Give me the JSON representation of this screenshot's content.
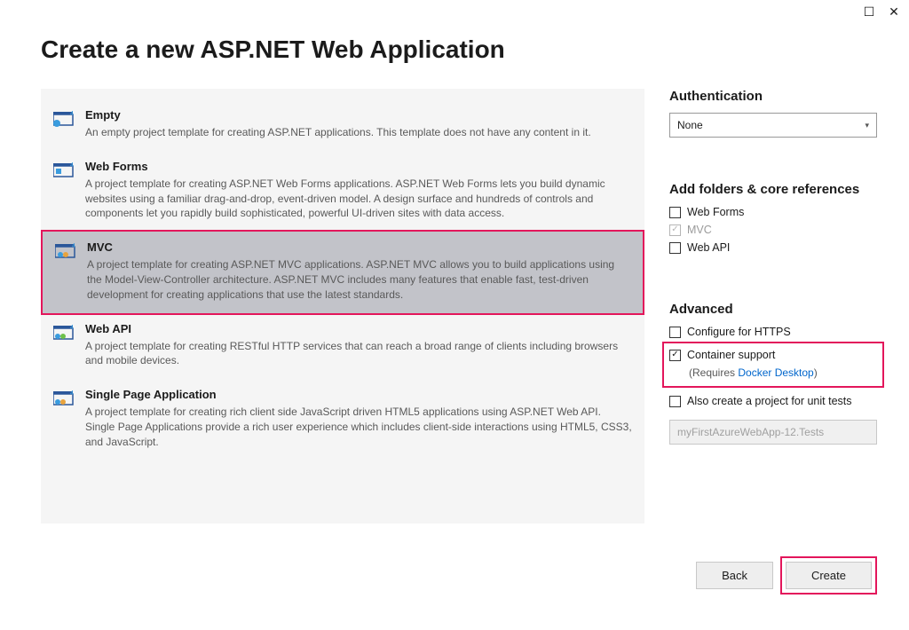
{
  "window": {
    "maximize": "☐",
    "close": "✕"
  },
  "title": "Create a new ASP.NET Web Application",
  "templates": [
    {
      "name": "Empty",
      "desc": "An empty project template for creating ASP.NET applications. This template does not have any content in it."
    },
    {
      "name": "Web Forms",
      "desc": "A project template for creating ASP.NET Web Forms applications. ASP.NET Web Forms lets you build dynamic websites using a familiar drag-and-drop, event-driven model. A design surface and hundreds of controls and components let you rapidly build sophisticated, powerful UI-driven sites with data access."
    },
    {
      "name": "MVC",
      "desc": "A project template for creating ASP.NET MVC applications. ASP.NET MVC allows you to build applications using the Model-View-Controller architecture. ASP.NET MVC includes many features that enable fast, test-driven development for creating applications that use the latest standards."
    },
    {
      "name": "Web API",
      "desc": "A project template for creating RESTful HTTP services that can reach a broad range of clients including browsers and mobile devices."
    },
    {
      "name": "Single Page Application",
      "desc": "A project template for creating rich client side JavaScript driven HTML5 applications using ASP.NET Web API. Single Page Applications provide a rich user experience which includes client-side interactions using HTML5, CSS3, and JavaScript."
    }
  ],
  "auth": {
    "heading": "Authentication",
    "value": "None"
  },
  "coreRefs": {
    "heading": "Add folders & core references",
    "webForms": "Web Forms",
    "mvc": "MVC",
    "webApi": "Web API"
  },
  "advanced": {
    "heading": "Advanced",
    "https": "Configure for HTTPS",
    "container": "Container support",
    "requiresPrefix": "(Requires ",
    "dockerLink": "Docker Desktop",
    "requiresSuffix": ")",
    "unitTests": "Also create a project for unit tests",
    "testProjectName": "myFirstAzureWebApp-12.Tests"
  },
  "buttons": {
    "back": "Back",
    "create": "Create"
  }
}
